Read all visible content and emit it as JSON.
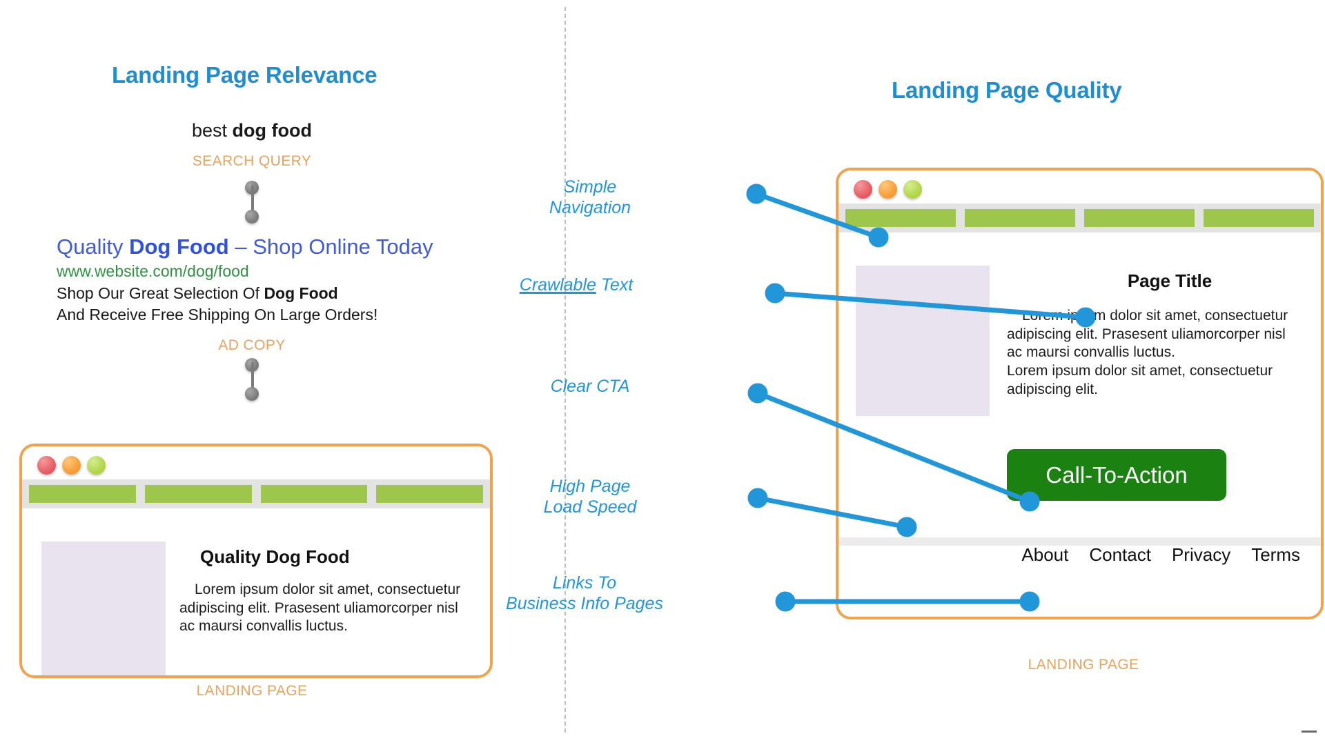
{
  "left_panel": {
    "title": "Landing Page Relevance",
    "search_query": {
      "prefix": "best ",
      "bold": "dog food"
    },
    "search_query_caption": "SEARCH QUERY",
    "ad": {
      "headline_part1": "Quality ",
      "headline_bold": "Dog Food",
      "headline_part2": " – Shop Online Today",
      "url": "www.website.com/dog/food",
      "desc_line1_a": "Shop Our Great Selection Of ",
      "desc_line1_bold": "Dog Food",
      "desc_line2": "And Receive Free Shipping On Large Orders!"
    },
    "ad_caption": "AD COPY",
    "landing_caption": "LANDING PAGE",
    "browser": {
      "nav_items": [
        "",
        "",
        "",
        ""
      ],
      "page_title": "Quality Dog Food",
      "body_copy": "Lorem ipsum dolor sit amet, consectuetur adipiscing elit. Prasesent uliamorcorper nisl ac maursi convallis luctus."
    }
  },
  "right_panel": {
    "title": "Landing Page Quality",
    "landing_caption": "LANDING PAGE",
    "callouts": [
      {
        "id": "simple-navigation",
        "text": "Simple\nNavigation"
      },
      {
        "id": "crawlable-text",
        "underlined": "Crawlable",
        "rest": " Text"
      },
      {
        "id": "clear-cta",
        "text": "Clear CTA"
      },
      {
        "id": "high-page-load-speed",
        "text": "High Page\nLoad Speed"
      },
      {
        "id": "links-to-business-info-pages",
        "text": "Links To\nBusiness Info Pages"
      }
    ],
    "browser": {
      "nav_items": [
        "",
        "",
        "",
        ""
      ],
      "page_title": "Page Title",
      "body_copy": "Lorem ipsum dolor sit amet, consectuetur adipiscing elit. Prasesent uliamorcorper nisl ac maursi convallis luctus.\nLorem ipsum dolor sit amet, consectuetur adipiscing elit.",
      "cta_label": "Call-To-Action",
      "footer_links": [
        "About",
        "Contact",
        "Privacy",
        "Terms"
      ]
    }
  },
  "colors": {
    "heading_blue": "#1f8ed1",
    "caption_orange": "#e8a35c",
    "frame_orange": "#f2a24a",
    "callout_blue": "#2196d8",
    "cta_green": "#1b8212",
    "nav_green": "#9ec64d",
    "ad_headline_blue": "#3f5bd9",
    "ad_url_green": "#2f9243"
  }
}
